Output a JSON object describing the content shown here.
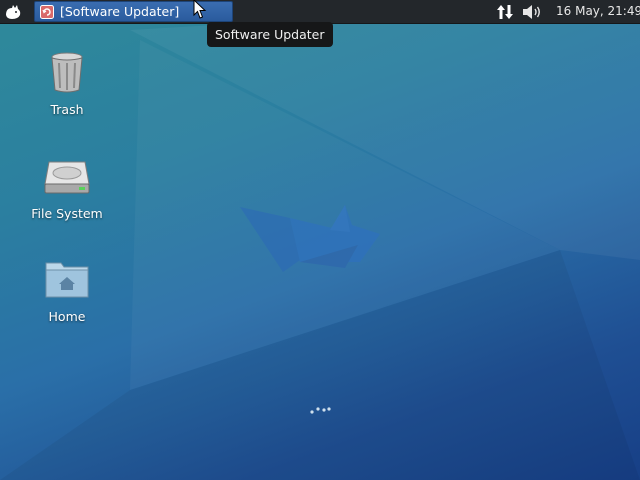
{
  "panel": {
    "app_menu_icon": "xfce-mouse-icon",
    "tasks": [
      {
        "label": "[Software Updater]",
        "icon": "software-updater-icon"
      }
    ],
    "tray": {
      "network_icon": "network-transfer-icon",
      "volume_icon": "volume-icon"
    },
    "clock": "16 May, 21:49"
  },
  "tooltip": {
    "text": "Software Updater"
  },
  "desktop": {
    "icons": [
      {
        "label": "Trash",
        "icon": "trash-icon"
      },
      {
        "label": "File System",
        "icon": "hard-drive-icon"
      },
      {
        "label": "Home",
        "icon": "home-folder-icon"
      }
    ]
  },
  "colors": {
    "panel_bg": "#23272b",
    "task_active_bg": "#2f64a8",
    "wallpaper_top": "#2f8a9a",
    "wallpaper_bottom": "#173f86"
  }
}
